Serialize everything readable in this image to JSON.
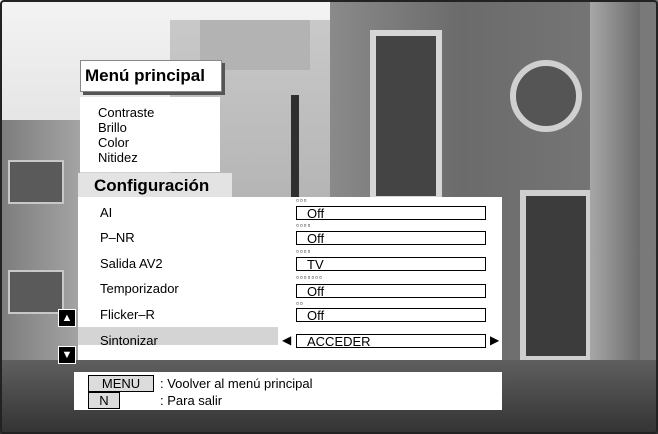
{
  "menu": {
    "title": "Menú principal",
    "items": [
      "Contraste",
      "Brillo",
      "Color",
      "Nitidez"
    ]
  },
  "configuracion": {
    "title": "Configuración",
    "rows": [
      {
        "label": "AI",
        "value": "Off",
        "dots": "▫▫▫"
      },
      {
        "label": "P–NR",
        "value": "Off",
        "dots": "▫▫▫▫"
      },
      {
        "label": "Salida AV2",
        "value": "TV",
        "dots": "▫▫▫▫"
      },
      {
        "label": "Temporizador",
        "value": "Off",
        "dots": "▫▫▫▫▫▫▫"
      },
      {
        "label": "Flicker–R",
        "value": "Off",
        "dots": "▫▫"
      },
      {
        "label": "Sintonizar",
        "value": "ACCEDER",
        "dots": ""
      }
    ]
  },
  "nav": {
    "up": "▲",
    "down": "▼",
    "left": "◀",
    "right": "▶"
  },
  "footer": {
    "keys": [
      {
        "key": "MENU",
        "desc": ": Voolver al menú principal"
      },
      {
        "key": "N",
        "desc": ": Para salir"
      }
    ]
  },
  "colors": {
    "menu_bg": "#ffffff",
    "header_bg": "#e3e3e3",
    "selected_bg": "#d4d4d4"
  }
}
